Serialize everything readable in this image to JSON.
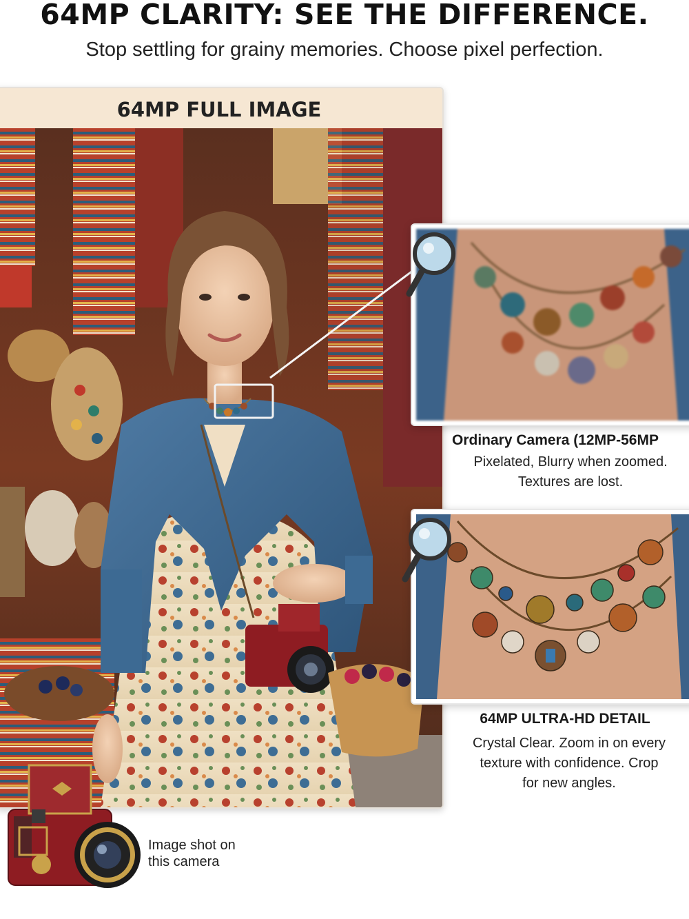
{
  "headline": "64MP CLARITY: SEE THE DIFFERENCE.",
  "subheadline": "Stop settling for grainy memories. Choose pixel perfection.",
  "full_image": {
    "label": "64MP FULL IMAGE"
  },
  "ordinary_camera": {
    "title": "Ordinary Camera (12MP-56MP",
    "line1": "Pixelated, Blurry when zoomed.",
    "line2": "Textures are lost."
  },
  "ultra_hd": {
    "title": "64MP ULTRA-HD DETAIL",
    "line1": "Crystal Clear. Zoom in on every",
    "line2": "texture with confidence. Crop",
    "line3": "for new angles."
  },
  "camera_note": {
    "line1": "Image shot on",
    "line2": "this camera"
  },
  "icons": [
    "magnifier-icon",
    "camera-icon"
  ],
  "colors": {
    "header_band": "#f6e7d3",
    "camera_red": "#8e1c22",
    "denim": "#3f6c96"
  }
}
